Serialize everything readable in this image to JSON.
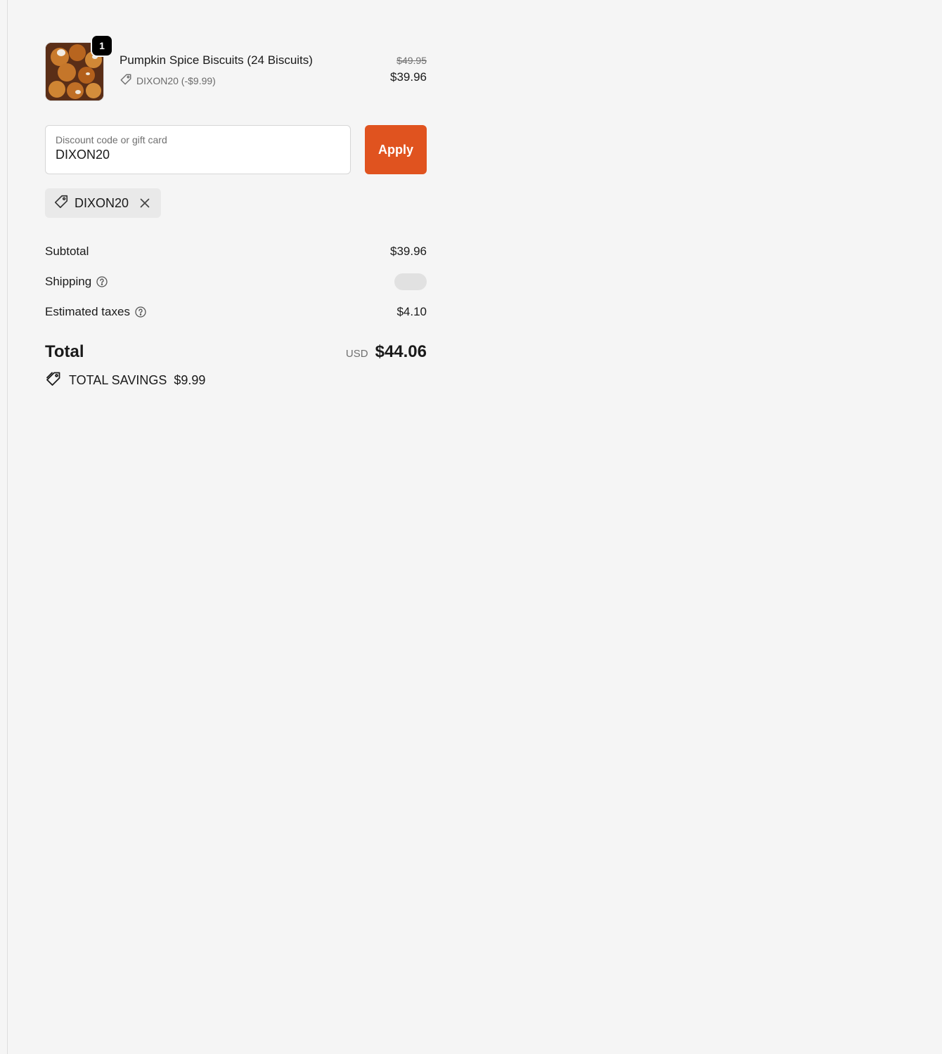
{
  "line_item": {
    "quantity": "1",
    "name": "Pumpkin Spice Biscuits (24 Biscuits)",
    "discount_label": "DIXON20 (-$9.99)",
    "original_price": "$49.95",
    "final_price": "$39.96",
    "image_icon": "product-photo"
  },
  "discount_form": {
    "label": "Discount code or gift card",
    "value": "DIXON20",
    "apply_label": "Apply"
  },
  "applied_code": {
    "code": "DIXON20",
    "icon": "tag-icon",
    "remove_icon": "close-icon"
  },
  "totals": {
    "subtotal_label": "Subtotal",
    "subtotal_value": "$39.96",
    "shipping_label": "Shipping",
    "taxes_label": "Estimated taxes",
    "taxes_value": "$4.10",
    "total_label": "Total",
    "currency": "USD",
    "total_value": "$44.06",
    "savings_label": "TOTAL SAVINGS",
    "savings_value": "$9.99"
  },
  "colors": {
    "accent": "#e0531f",
    "background": "#f5f5f5"
  }
}
